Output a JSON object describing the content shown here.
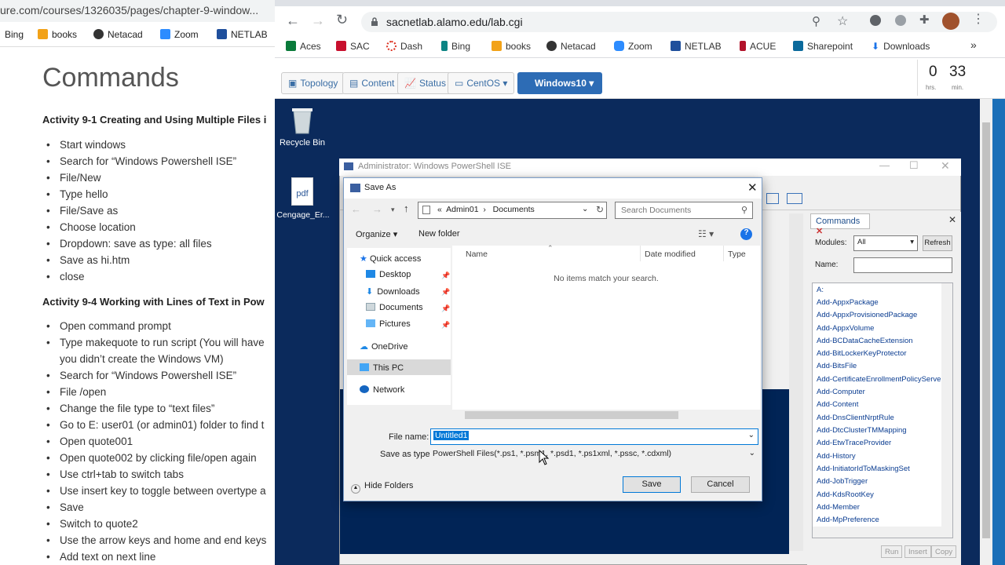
{
  "left_page": {
    "url": "ure.com/courses/1326035/pages/chapter-9-window...",
    "bookmarks": [
      "Bing",
      "books",
      "Netacad",
      "Zoom",
      "NETLAB"
    ],
    "title": "Commands",
    "heading1": "Activity 9-1 Creating and Using Multiple Files i",
    "list1": [
      "Start windows",
      "Search for “Windows Powershell ISE”",
      "File/New",
      "Type hello",
      "File/Save as",
      "Choose location",
      "Dropdown: save as type: all files",
      "Save as hi.htm",
      "close"
    ],
    "heading2": "Activity 9-4 Working with Lines of Text in Pow",
    "list2": [
      "Open command prompt",
      "Type makequote to run script (You will have",
      "you didn’t create the Windows VM)",
      "Search for “Windows Powershell ISE”",
      "File /open",
      "Change the file type to “text files”",
      "Go to E: user01 (or admin01) folder to find t",
      "Open quote001",
      "Open quote002 by clicking file/open again",
      "Use ctrl+tab to switch tabs",
      "Use insert key to toggle between overtype a",
      "Save",
      "Switch to quote2",
      "Use the arrow keys and home and end keys",
      "Add text on next line"
    ]
  },
  "browser": {
    "url": "sacnetlab.alamo.edu/lab.cgi",
    "bookmarks": [
      "Aces",
      "SAC",
      "Dash",
      "Bing",
      "books",
      "Netacad",
      "Zoom",
      "NETLAB",
      "ACUE",
      "Sharepoint",
      "Downloads"
    ],
    "overflow": "»"
  },
  "lab": {
    "tabs": [
      "Topology",
      "Content",
      "Status",
      "CentOS"
    ],
    "active_tab": "Windows10",
    "timer": {
      "hours": "0",
      "minutes": "33",
      "hours_label": "hrs.",
      "minutes_label": "min."
    }
  },
  "desktop": {
    "icons": [
      "Recycle Bin",
      "Cengage_Er..."
    ],
    "pdf_label": "pdf"
  },
  "ise": {
    "title": "Administrator: Windows PowerShell ISE",
    "commands": {
      "tab": "Commands",
      "modules_label": "Modules:",
      "modules_value": "All",
      "refresh": "Refresh",
      "name_label": "Name:",
      "items": [
        "A:",
        "Add-AppxPackage",
        "Add-AppxProvisionedPackage",
        "Add-AppxVolume",
        "Add-BCDataCacheExtension",
        "Add-BitLockerKeyProtector",
        "Add-BitsFile",
        "Add-CertificateEnrollmentPolicyServe",
        "Add-Computer",
        "Add-Content",
        "Add-DnsClientNrptRule",
        "Add-DtcClusterTMMapping",
        "Add-EtwTraceProvider",
        "Add-History",
        "Add-InitiatorIdToMaskingSet",
        "Add-JobTrigger",
        "Add-KdsRootKey",
        "Add-Member",
        "Add-MpPreference"
      ],
      "buttons": [
        "Run",
        "Insert",
        "Copy"
      ]
    }
  },
  "dialog": {
    "title": "Save As",
    "path": [
      "«",
      "Admin01",
      "Documents"
    ],
    "search_placeholder": "Search Documents",
    "organize": "Organize",
    "new_folder": "New folder",
    "columns": [
      "Name",
      "Date modified",
      "Type"
    ],
    "empty_message": "No items match your search.",
    "nav": [
      "Quick access",
      "Desktop",
      "Downloads",
      "Documents",
      "Pictures",
      "OneDrive",
      "This PC",
      "Network"
    ],
    "file_name_label": "File name:",
    "file_name": "Untitled1",
    "save_type_label": "Save as type:",
    "save_type": "PowerShell Files(*.ps1, *.psm1, *.psd1, *.ps1xml, *.pssc, *.cdxml)",
    "hide_folders": "Hide Folders",
    "save": "Save",
    "cancel": "Cancel"
  }
}
